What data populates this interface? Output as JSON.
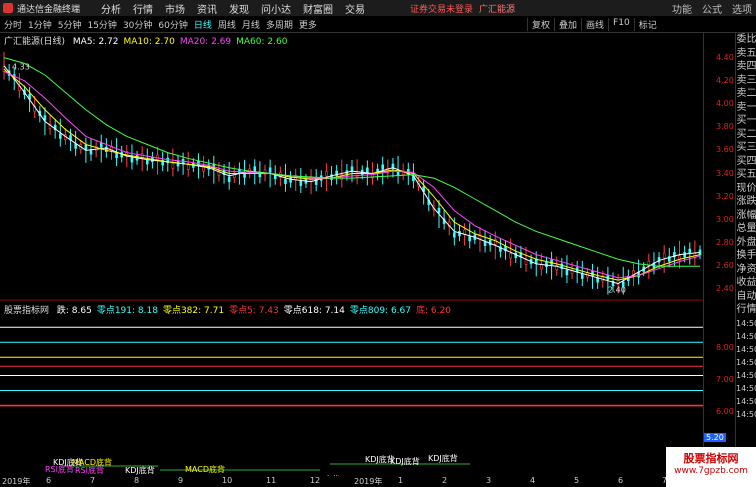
{
  "window": {
    "title": "通达信金融终端",
    "notice": "证券交易未登录",
    "broker": "广汇能源"
  },
  "menu": [
    "分析",
    "行情",
    "市场",
    "资讯",
    "发现",
    "问小达",
    "财富圈",
    "交易"
  ],
  "window_controls": [
    "功能",
    "公式",
    "选项"
  ],
  "periods": [
    "分时",
    "1分钟",
    "5分钟",
    "15分钟",
    "30分钟",
    "60分钟",
    "日线",
    "周线",
    "月线",
    "多周期",
    "更多"
  ],
  "active_period": "日线",
  "tools": [
    "复权",
    "叠加",
    "画线",
    "F10",
    "标记"
  ],
  "stock_label": "广汇能源(日线)",
  "ma": [
    {
      "label": "MA5: 2.72",
      "color": "#ffffff"
    },
    {
      "label": "MA10: 2.70",
      "color": "#ffff00"
    },
    {
      "label": "MA20: 2.69",
      "color": "#ff44ff"
    },
    {
      "label": "MA60: 2.60",
      "color": "#44ff44"
    }
  ],
  "price_ticks": [
    "4.40",
    "4.20",
    "4.00",
    "3.80",
    "3.60",
    "3.40",
    "3.20",
    "3.00",
    "2.80",
    "2.60",
    "2.40"
  ],
  "high_label": "4.33",
  "low_label": "2.40",
  "indicator": {
    "name": "股票指标网",
    "items": [
      {
        "label": "跌: 8.65",
        "color": "#ffffff"
      },
      {
        "label": "零点191: 8.18",
        "color": "#3ff"
      },
      {
        "label": "零点382: 7.71",
        "color": "#ffff00"
      },
      {
        "label": "零点5: 7.43",
        "color": "#ff3333"
      },
      {
        "label": "零点618: 7.14",
        "color": "#ffffff"
      },
      {
        "label": "零点809: 6.67",
        "color": "#3ff"
      },
      {
        "label": "底: 6.20",
        "color": "#ff3333"
      }
    ]
  },
  "lower_ticks": [
    "8.00",
    "7.00",
    "6.00",
    "5.20"
  ],
  "side_panel": [
    "委比",
    "卖五",
    "卖四",
    "卖三",
    "卖二",
    "卖一",
    "买一",
    "买二",
    "买三",
    "买四",
    "买五",
    "现价",
    "涨跌",
    "涨幅",
    "总量",
    "外盘",
    "换手",
    "净资",
    "收益",
    "自动",
    "行情",
    "14:50",
    "14:50",
    "14:50",
    "14:50",
    "14:50",
    "14:50",
    "14:50",
    "14:50"
  ],
  "signals": [
    {
      "text": "KDJ底背",
      "color": "#ffffff"
    },
    {
      "text": "RSI底背",
      "color": "#ff44ff"
    },
    {
      "text": "MACD底背",
      "color": "#ffff00"
    },
    {
      "text": "RSI底背",
      "color": "#ff44ff"
    },
    {
      "text": "KDJ底背",
      "color": "#ffffff"
    },
    {
      "text": "MACD底背",
      "color": "#ffff00"
    },
    {
      "text": "KDJ底背",
      "color": "#ffffff"
    },
    {
      "text": "KDJ底背",
      "color": "#ffffff"
    },
    {
      "text": "KDJ底背",
      "color": "#ffffff"
    },
    {
      "text": "KDJ底背",
      "color": "#ffffff"
    },
    {
      "text": "MACD底背",
      "color": "#ffff00"
    },
    {
      "text": "RSI底背",
      "color": "#ff44ff"
    }
  ],
  "chart_marks": [
    "解",
    "跌"
  ],
  "dates": [
    "2019年",
    "6",
    "7",
    "8",
    "9",
    "10",
    "11",
    "12",
    "2019年",
    "1",
    "2",
    "3",
    "4",
    "5",
    "6",
    "7"
  ],
  "watermark": {
    "line1": "股票指标网",
    "line2": "www.7gpzb.com"
  },
  "chart_data": {
    "type": "line",
    "series": [
      {
        "name": "MA5",
        "values": [
          4.33,
          4.1,
          3.85,
          3.72,
          3.6,
          3.62,
          3.55,
          3.52,
          3.5,
          3.48,
          3.45,
          3.38,
          3.42,
          3.4,
          3.35,
          3.33,
          3.38,
          3.42,
          3.4,
          3.45,
          3.38,
          3.1,
          2.9,
          2.85,
          2.78,
          2.7,
          2.62,
          2.6,
          2.55,
          2.5,
          2.45,
          2.55,
          2.65,
          2.7,
          2.72
        ]
      },
      {
        "name": "MA10",
        "values": [
          4.3,
          4.15,
          3.95,
          3.78,
          3.65,
          3.6,
          3.56,
          3.53,
          3.5,
          3.48,
          3.46,
          3.4,
          3.4,
          3.4,
          3.37,
          3.35,
          3.36,
          3.4,
          3.4,
          3.43,
          3.4,
          3.2,
          2.98,
          2.88,
          2.82,
          2.73,
          2.66,
          2.62,
          2.57,
          2.52,
          2.48,
          2.52,
          2.6,
          2.66,
          2.7
        ]
      },
      {
        "name": "MA20",
        "values": [
          4.28,
          4.2,
          4.05,
          3.88,
          3.72,
          3.65,
          3.58,
          3.55,
          3.52,
          3.5,
          3.47,
          3.42,
          3.41,
          3.4,
          3.38,
          3.36,
          3.36,
          3.38,
          3.39,
          3.42,
          3.41,
          3.28,
          3.08,
          2.95,
          2.86,
          2.78,
          2.7,
          2.65,
          2.6,
          2.55,
          2.5,
          2.52,
          2.58,
          2.64,
          2.69
        ]
      },
      {
        "name": "MA60",
        "values": [
          4.4,
          4.35,
          4.25,
          4.1,
          3.95,
          3.82,
          3.72,
          3.65,
          3.58,
          3.53,
          3.49,
          3.45,
          3.42,
          3.4,
          3.38,
          3.37,
          3.36,
          3.36,
          3.37,
          3.38,
          3.39,
          3.36,
          3.28,
          3.18,
          3.08,
          2.98,
          2.9,
          2.84,
          2.78,
          2.72,
          2.66,
          2.62,
          2.6,
          2.6,
          2.6
        ]
      }
    ],
    "ylim": [
      2.3,
      4.5
    ]
  }
}
